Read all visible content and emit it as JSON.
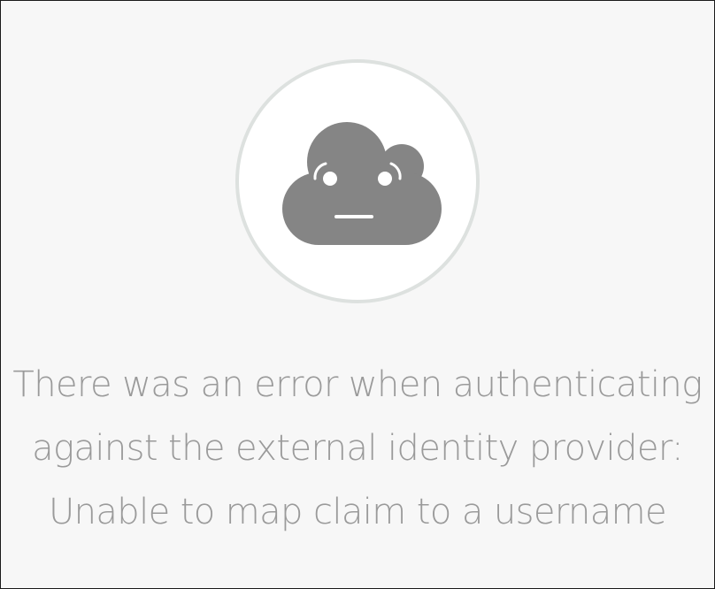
{
  "error": {
    "icon": "sad-cloud-icon",
    "lines": [
      "There was an error when authenticating",
      "against the external identity provider:",
      "Unable to map claim to a username"
    ]
  },
  "colors": {
    "background": "#f7f7f7",
    "circle_fill": "#ffffff",
    "circle_border": "#dde1df",
    "cloud": "#858585",
    "text": "#9a9a9a"
  }
}
